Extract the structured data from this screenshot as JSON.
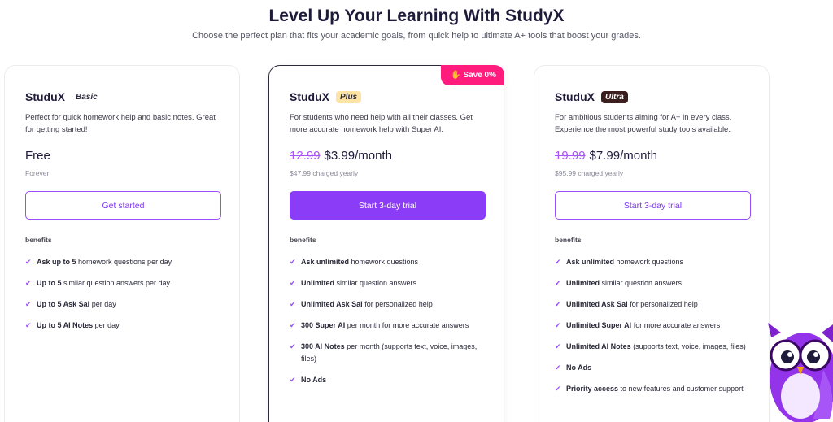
{
  "header": {
    "title": "Level Up Your Learning With StudyX",
    "subtitle": "Choose the perfect plan that fits your academic goals, from quick help to ultimate A+ tools that boost your grades."
  },
  "plans": [
    {
      "brand": "StuduX",
      "tier": "Basic",
      "description": "Perfect for quick homework help and basic notes. Great for getting started!",
      "price_old": "",
      "price": "Free",
      "price_note": "Forever",
      "cta": "Get started",
      "benefits_label": "benefits",
      "benefits": [
        {
          "bold": "Ask up to 5",
          "rest": " homework questions per day"
        },
        {
          "bold": "Up to 5",
          "rest": " similar question answers per day"
        },
        {
          "bold": "Up to 5 Ask Sai",
          "rest": " per day"
        },
        {
          "bold": "Up to 5 AI Notes",
          "rest": " per day"
        }
      ]
    },
    {
      "brand": "StuduX",
      "tier": "Plus",
      "badge": "Save 0%",
      "description": "For students who need help with all their classes. Get more accurate homework help with Super AI.",
      "price_old": "12.99",
      "price": "$3.99/month",
      "price_note": "$47.99 charged yearly",
      "cta": "Start 3-day trial",
      "benefits_label": "benefits",
      "benefits": [
        {
          "bold": "Ask unlimited",
          "rest": " homework questions"
        },
        {
          "bold": "Unlimited",
          "rest": " similar question answers"
        },
        {
          "bold": "Unlimited Ask Sai",
          "rest": " for personalized help"
        },
        {
          "bold": "300 Super AI",
          "rest": " per month for more accurate answers"
        },
        {
          "bold": "300 AI Notes",
          "rest": " per month (supports text, voice, images, files)"
        },
        {
          "bold": "No Ads",
          "rest": ""
        }
      ]
    },
    {
      "brand": "StuduX",
      "tier": "Ultra",
      "description": "For ambitious students aiming for A+ in every class. Experience the most powerful study tools available.",
      "price_old": "19.99",
      "price": "$7.99/month",
      "price_note": "$95.99 charged yearly",
      "cta": "Start 3-day trial",
      "benefits_label": "benefits",
      "benefits": [
        {
          "bold": "Ask unlimited",
          "rest": " homework questions"
        },
        {
          "bold": "Unlimited",
          "rest": " similar question answers"
        },
        {
          "bold": "Unlimited Ask Sai",
          "rest": " for personalized help"
        },
        {
          "bold": "Unlimited Super AI",
          "rest": " for more accurate answers"
        },
        {
          "bold": "Unlimited AI Notes",
          "rest": " (supports text, voice, images, files)"
        },
        {
          "bold": "No Ads",
          "rest": ""
        },
        {
          "bold": "Priority access",
          "rest": " to new features and customer support"
        }
      ]
    }
  ],
  "colors": {
    "accent": "#8b3cf7",
    "badge": "#ff1c7d",
    "check": "#9b4dff"
  },
  "icons": {
    "check": "checkmark-icon",
    "badge": "waving-hand-icon",
    "mascot": "owl-mascot"
  }
}
